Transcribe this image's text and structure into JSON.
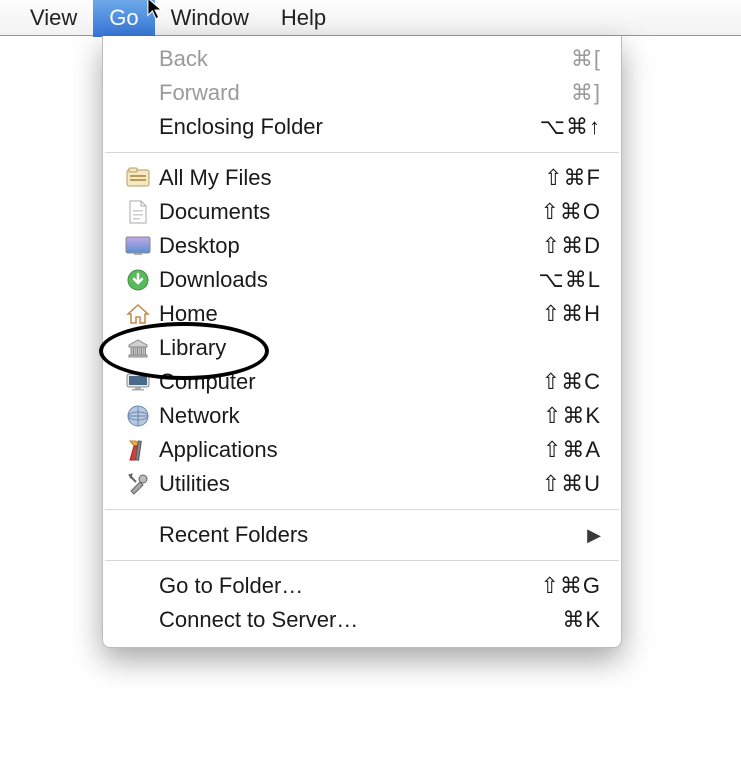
{
  "menubar": {
    "items": [
      {
        "label": "View",
        "active": false
      },
      {
        "label": "Go",
        "active": true
      },
      {
        "label": "Window",
        "active": false
      },
      {
        "label": "Help",
        "active": false
      }
    ]
  },
  "dropdown": {
    "groups": [
      [
        {
          "id": "back",
          "label": "Back",
          "shortcut": "⌘[",
          "disabled": true,
          "icon": null
        },
        {
          "id": "forward",
          "label": "Forward",
          "shortcut": "⌘]",
          "disabled": true,
          "icon": null
        },
        {
          "id": "enclosing",
          "label": "Enclosing Folder",
          "shortcut": "⌥⌘↑",
          "disabled": false,
          "icon": null
        }
      ],
      [
        {
          "id": "allmyfiles",
          "label": "All My Files",
          "shortcut": "⇧⌘F",
          "disabled": false,
          "icon": "allmyfiles"
        },
        {
          "id": "documents",
          "label": "Documents",
          "shortcut": "⇧⌘O",
          "disabled": false,
          "icon": "documents"
        },
        {
          "id": "desktop",
          "label": "Desktop",
          "shortcut": "⇧⌘D",
          "disabled": false,
          "icon": "desktop"
        },
        {
          "id": "downloads",
          "label": "Downloads",
          "shortcut": "⌥⌘L",
          "disabled": false,
          "icon": "downloads"
        },
        {
          "id": "home",
          "label": "Home",
          "shortcut": "⇧⌘H",
          "disabled": false,
          "icon": "home"
        },
        {
          "id": "library",
          "label": "Library",
          "shortcut": "",
          "disabled": false,
          "icon": "library"
        },
        {
          "id": "computer",
          "label": "Computer",
          "shortcut": "⇧⌘C",
          "disabled": false,
          "icon": "computer"
        },
        {
          "id": "network",
          "label": "Network",
          "shortcut": "⇧⌘K",
          "disabled": false,
          "icon": "network"
        },
        {
          "id": "applications",
          "label": "Applications",
          "shortcut": "⇧⌘A",
          "disabled": false,
          "icon": "applications"
        },
        {
          "id": "utilities",
          "label": "Utilities",
          "shortcut": "⇧⌘U",
          "disabled": false,
          "icon": "utilities"
        }
      ],
      [
        {
          "id": "recentfolders",
          "label": "Recent Folders",
          "shortcut": "",
          "disabled": false,
          "icon": null,
          "submenu": true
        }
      ],
      [
        {
          "id": "gotofolder",
          "label": "Go to Folder…",
          "shortcut": "⇧⌘G",
          "disabled": false,
          "icon": null
        },
        {
          "id": "connecttoserver",
          "label": "Connect to Server…",
          "shortcut": "⌘K",
          "disabled": false,
          "icon": null
        }
      ]
    ]
  },
  "annotation": {
    "highlighted": "library"
  }
}
